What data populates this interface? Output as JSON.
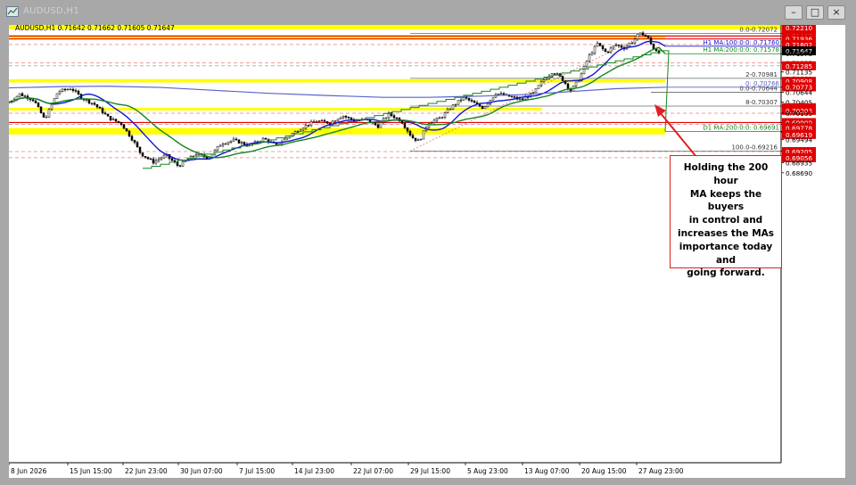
{
  "window": {
    "title": "AUDUSD,H1",
    "buttons": [
      "minimize",
      "restore",
      "close"
    ]
  },
  "chart_header": "AUDUSD,H1  0.71642 0.71662 0.71605 0.71647",
  "callout": {
    "lines": [
      "Holding the 200 hour",
      "MA keeps the buyers",
      "in control and",
      "increases the MAs",
      "importance today and",
      "going forward."
    ]
  },
  "chart_data": {
    "type": "candlestick",
    "symbol": "AUDUSD",
    "timeframe": "H1",
    "ohlc_last": {
      "open": 0.71642,
      "high": 0.71662,
      "low": 0.71605,
      "close": 0.71647
    },
    "y_ticks": [
      0.7221,
      0.72072,
      0.72007,
      0.71936,
      0.71865,
      0.71802,
      0.71647,
      0.71578,
      0.71355,
      0.71285,
      0.71135,
      0.70981,
      0.70908,
      0.70766,
      0.70773,
      0.70644,
      0.70405,
      0.70307,
      0.70269,
      0.70203,
      0.70135,
      0.6991,
      0.69909,
      0.69865,
      0.69778,
      0.6967,
      0.69691,
      0.69619,
      0.69494,
      0.69216,
      0.69205,
      0.69056,
      0.68935,
      0.6869
    ],
    "red_price_labels": [
      0.7221,
      0.72007,
      0.71936,
      0.71802,
      0.71285,
      0.70908,
      0.70773,
      0.70269,
      0.70203,
      0.69909,
      0.69778,
      0.69619,
      0.69205,
      0.69056
    ],
    "highlighted_price_labels": [
      0.71647
    ],
    "x_ticks": [
      "8 Jun 2026",
      "15 Jun 15:00",
      "22 Jun 23:00",
      "30 Jun 07:00",
      "7 Jul 15:00",
      "14 Jul 23:00",
      "22 Jul 07:00",
      "29 Jul 15:00",
      "5 Aug 23:00",
      "13 Aug 07:00",
      "20 Aug 15:00",
      "27 Aug 23:00"
    ],
    "fib_levels": [
      {
        "label": "0.0-0.72072",
        "value": 0.72072
      },
      {
        "label": "2-0.70981",
        "value": 0.70981
      },
      {
        "label": "0.0-0.70644",
        "value": 0.70644
      },
      {
        "label": "8-0.70307",
        "value": 0.70307
      },
      {
        "label": "100.0-0.69216",
        "value": 0.69216
      }
    ],
    "moving_averages": [
      {
        "label": "H1 MA:100:0:0: 0.71760",
        "value": 0.7176,
        "color": "#1414d2"
      },
      {
        "label": "H1 MA:200:0:0: 0.71578",
        "value": 0.71578,
        "color": "#16861e"
      },
      {
        "label": "0: 0.70766",
        "value": 0.70766,
        "color": "#5a64c8"
      },
      {
        "label": "D1 MA:200:0:0: 0.69691",
        "value": 0.69691,
        "color": "#16861e"
      }
    ],
    "colors": {
      "ma100": "#1414d2",
      "ma200": "#16861e",
      "zone": "#ffff00",
      "level": "#e00000",
      "arrow": "#e02020"
    }
  }
}
